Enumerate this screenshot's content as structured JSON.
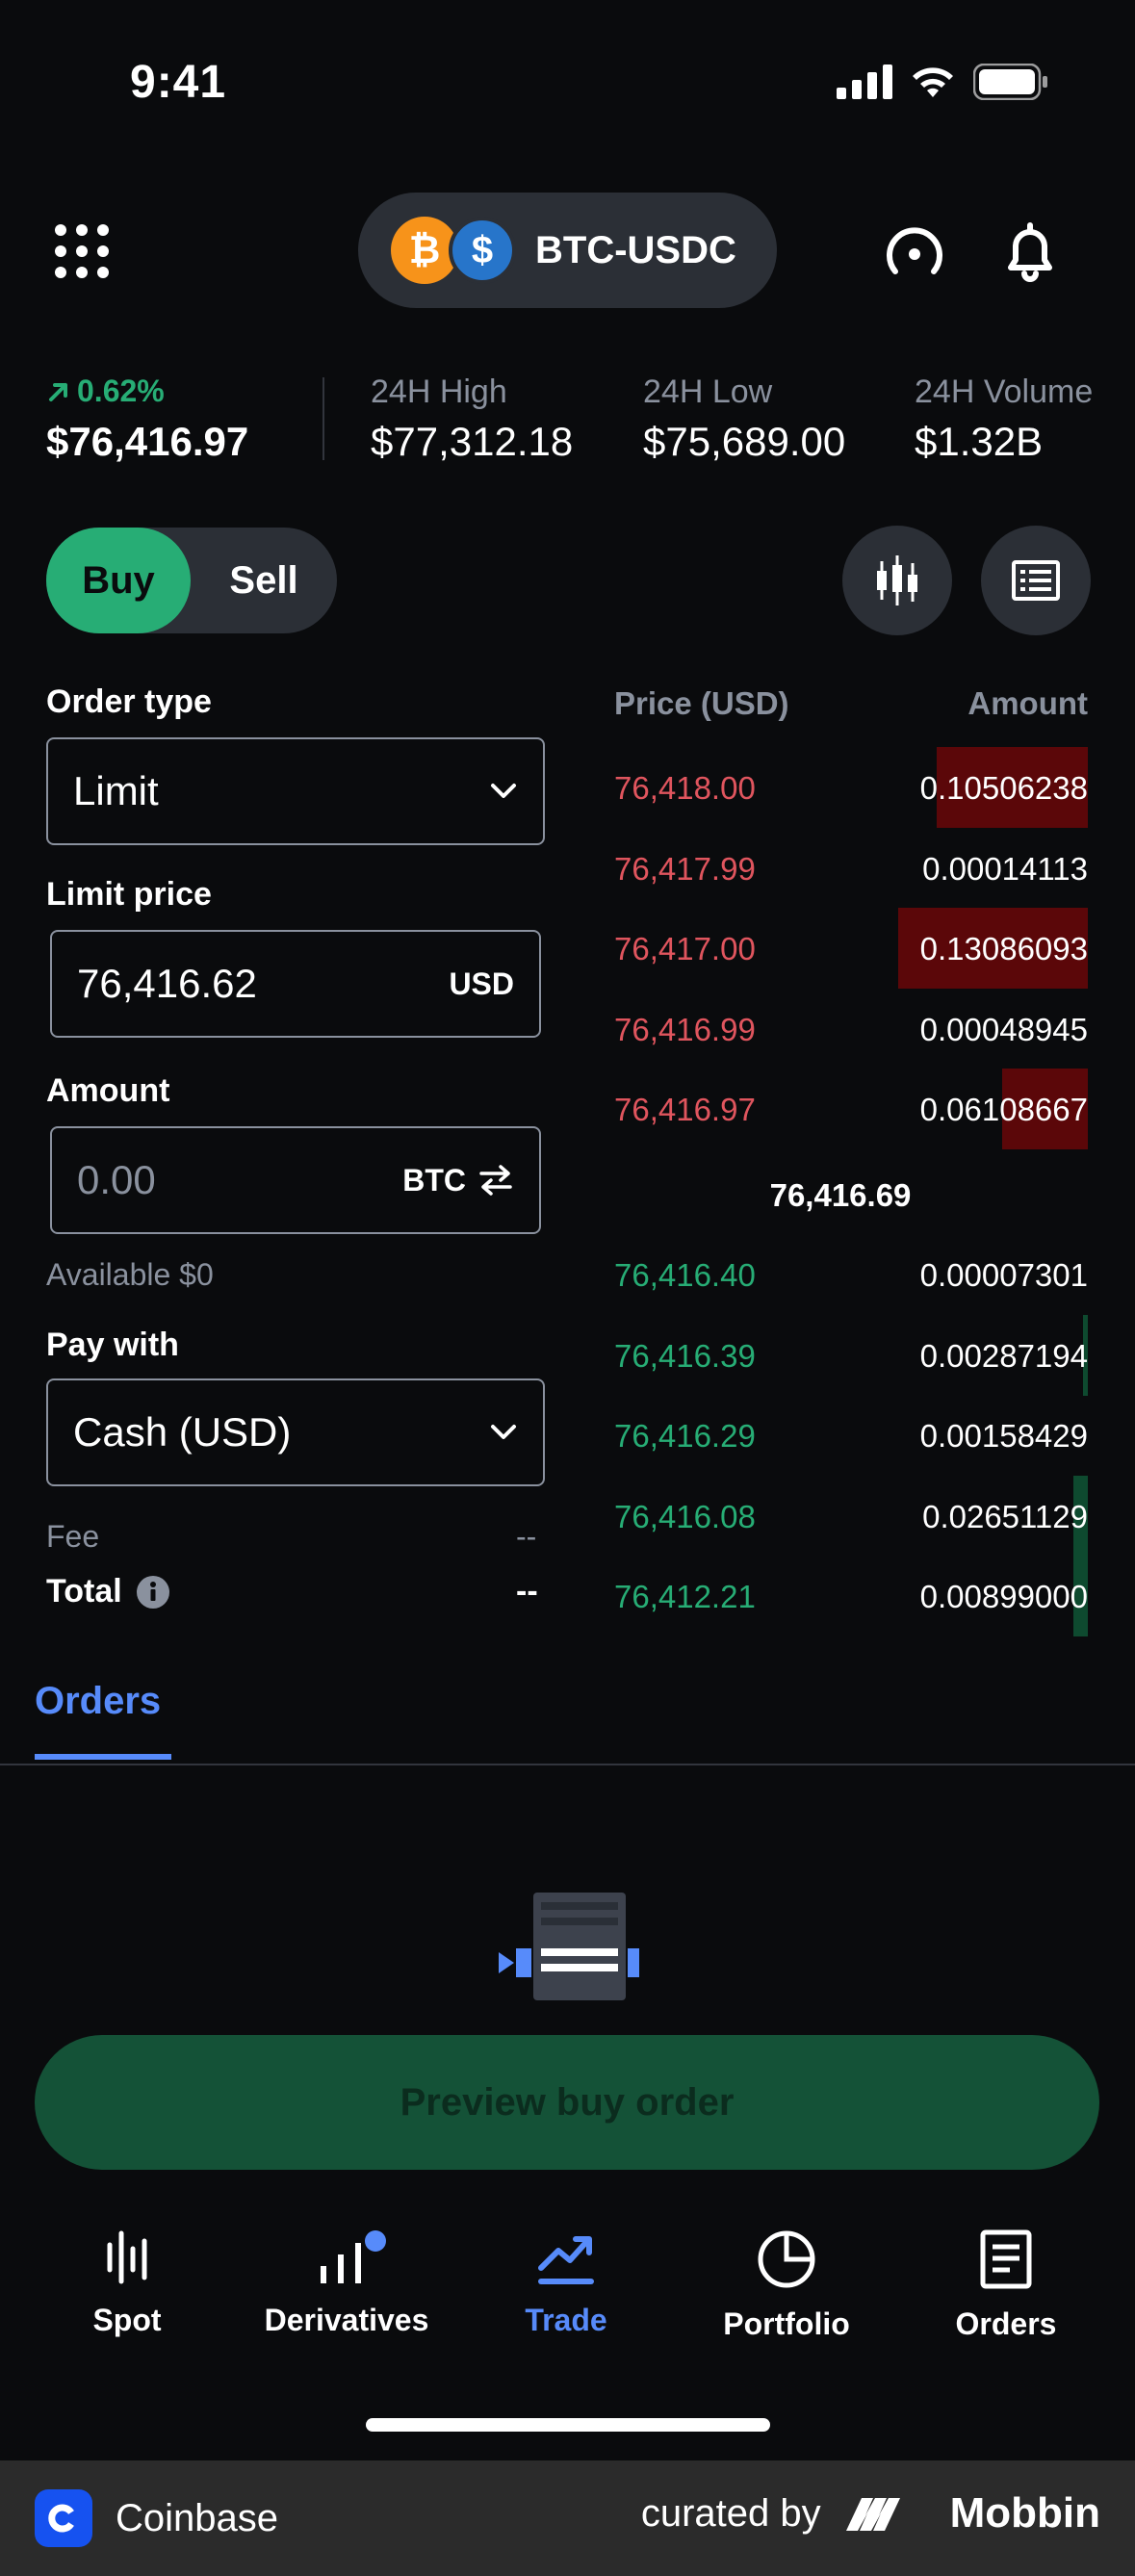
{
  "status": {
    "time": "9:41"
  },
  "header": {
    "pair": "BTC-USDC",
    "btc_symbol": "₿",
    "usdc_symbol": "$"
  },
  "stats": {
    "change": "0.62%",
    "price": "$76,416.97",
    "high_label": "24H High",
    "high_value": "$77,312.18",
    "low_label": "24H Low",
    "low_value": "$75,689.00",
    "volume_label": "24H Volume",
    "volume_value": "$1.32B"
  },
  "toggle": {
    "buy": "Buy",
    "sell": "Sell",
    "selected": "Buy"
  },
  "form": {
    "order_type_label": "Order type",
    "order_type_value": "Limit",
    "limit_price_label": "Limit price",
    "limit_price_value": "76,416.62",
    "limit_price_unit": "USD",
    "amount_label": "Amount",
    "amount_placeholder": "0.00",
    "amount_unit": "BTC",
    "available_label": "Available",
    "available_value": "$0",
    "pay_with_label": "Pay with",
    "pay_with_value": "Cash (USD)",
    "fee_label": "Fee",
    "fee_value": "--",
    "total_label": "Total",
    "total_value": "--"
  },
  "orderbook": {
    "price_header": "Price (USD)",
    "amount_header": "Amount",
    "asks": [
      {
        "price": "76,418.00",
        "amount": "0.10506238",
        "depth": 0.32
      },
      {
        "price": "76,417.99",
        "amount": "0.00014113",
        "depth": 0.0
      },
      {
        "price": "76,417.00",
        "amount": "0.13086093",
        "depth": 0.4
      },
      {
        "price": "76,416.99",
        "amount": "0.00048945",
        "depth": 0.0
      },
      {
        "price": "76,416.97",
        "amount": "0.06108667",
        "depth": 0.18
      }
    ],
    "mid": "76,416.69",
    "bids": [
      {
        "price": "76,416.40",
        "amount": "0.00007301",
        "depth": 0.0
      },
      {
        "price": "76,416.39",
        "amount": "0.00287194",
        "depth": 0.01
      },
      {
        "price": "76,416.29",
        "amount": "0.00158429",
        "depth": 0.0
      },
      {
        "price": "76,416.08",
        "amount": "0.02651129",
        "depth": 0.03
      },
      {
        "price": "76,412.21",
        "amount": "0.00899000",
        "depth": 0.03
      }
    ]
  },
  "orders_tab": {
    "label": "Orders"
  },
  "preview_button": {
    "label": "Preview buy order"
  },
  "nav": {
    "items": [
      {
        "label": "Spot"
      },
      {
        "label": "Derivatives"
      },
      {
        "label": "Trade"
      },
      {
        "label": "Portfolio"
      },
      {
        "label": "Orders"
      }
    ],
    "active": "Trade"
  },
  "footer": {
    "brand": "Coinbase",
    "curated_by": "curated by",
    "mobbin": "Mobbin"
  },
  "colors": {
    "background": "#0a0b0d",
    "green": "#27ad75",
    "red": "#e0555e",
    "accent": "#578bfa"
  }
}
